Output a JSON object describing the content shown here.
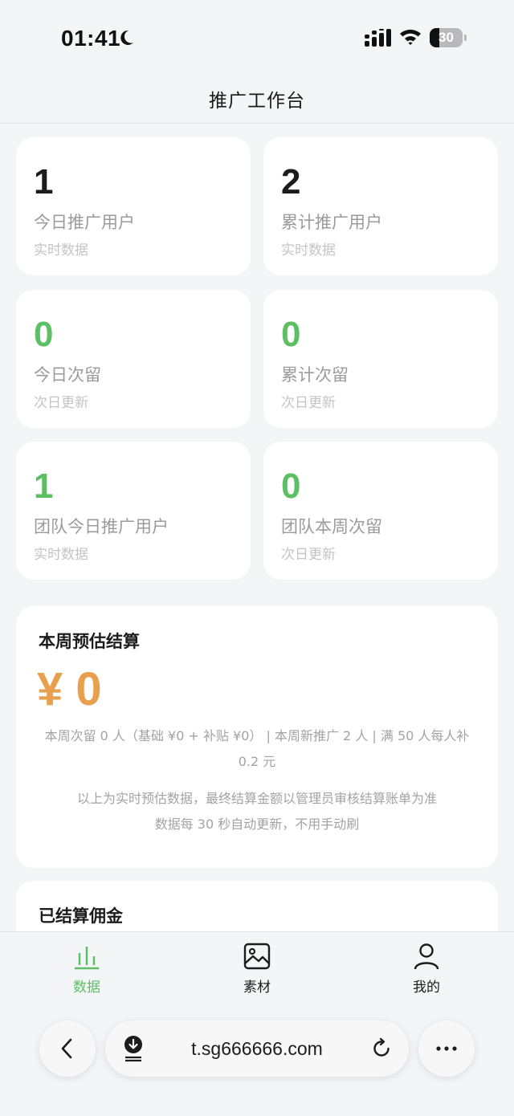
{
  "status_bar": {
    "time": "01:41",
    "battery": 30,
    "battery_label": "30"
  },
  "header": {
    "title": "推广工作台"
  },
  "stats": [
    {
      "value": "1",
      "label": "今日推广用户",
      "note": "实时数据",
      "value_color": "#1c1c1c"
    },
    {
      "value": "2",
      "label": "累计推广用户",
      "note": "实时数据",
      "value_color": "#1c1c1c"
    },
    {
      "value": "0",
      "label": "今日次留",
      "note": "次日更新",
      "value_color": "#5cbf63"
    },
    {
      "value": "0",
      "label": "累计次留",
      "note": "次日更新",
      "value_color": "#5cbf63"
    },
    {
      "value": "1",
      "label": "团队今日推广用户",
      "note": "实时数据",
      "value_color": "#5cbf63"
    },
    {
      "value": "0",
      "label": "团队本周次留",
      "note": "次日更新",
      "value_color": "#5cbf63"
    }
  ],
  "settlement": {
    "title": "本周预估结算",
    "amount": "¥ 0",
    "desc": "本周次留 0 人（基础 ¥0 + 补贴 ¥0） | 本周新推广 2 人 | 满 50 人每人补 0.2 元",
    "foot_line1": "以上为实时预估数据，最终结算金额以管理员审核结算账单为准",
    "foot_line2": "数据每 30 秒自动更新，不用手动刷",
    "amount_color": "#e8a04e"
  },
  "paid": {
    "title": "已结算佣金"
  },
  "tabs": [
    {
      "label": "数据",
      "icon": "bar-chart-icon",
      "active": true
    },
    {
      "label": "素材",
      "icon": "image-icon",
      "active": false
    },
    {
      "label": "我的",
      "icon": "user-icon",
      "active": false
    }
  ],
  "browser": {
    "url": "t.sg666666.com"
  },
  "colors": {
    "accent_green": "#5cbf63",
    "amount_orange": "#e8a04e"
  }
}
